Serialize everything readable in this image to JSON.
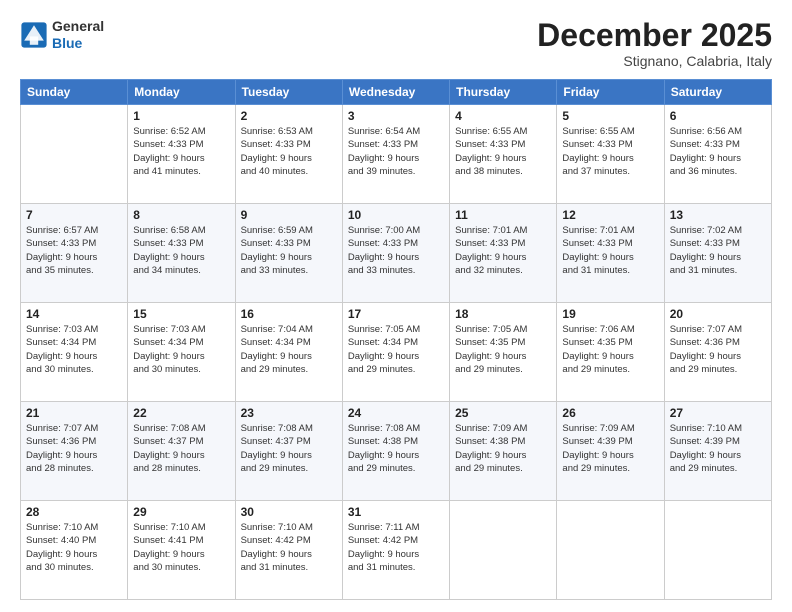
{
  "logo": {
    "general": "General",
    "blue": "Blue"
  },
  "header": {
    "month": "December 2025",
    "location": "Stignano, Calabria, Italy"
  },
  "weekdays": [
    "Sunday",
    "Monday",
    "Tuesday",
    "Wednesday",
    "Thursday",
    "Friday",
    "Saturday"
  ],
  "weeks": [
    [
      {
        "day": "",
        "info": ""
      },
      {
        "day": "1",
        "info": "Sunrise: 6:52 AM\nSunset: 4:33 PM\nDaylight: 9 hours\nand 41 minutes."
      },
      {
        "day": "2",
        "info": "Sunrise: 6:53 AM\nSunset: 4:33 PM\nDaylight: 9 hours\nand 40 minutes."
      },
      {
        "day": "3",
        "info": "Sunrise: 6:54 AM\nSunset: 4:33 PM\nDaylight: 9 hours\nand 39 minutes."
      },
      {
        "day": "4",
        "info": "Sunrise: 6:55 AM\nSunset: 4:33 PM\nDaylight: 9 hours\nand 38 minutes."
      },
      {
        "day": "5",
        "info": "Sunrise: 6:55 AM\nSunset: 4:33 PM\nDaylight: 9 hours\nand 37 minutes."
      },
      {
        "day": "6",
        "info": "Sunrise: 6:56 AM\nSunset: 4:33 PM\nDaylight: 9 hours\nand 36 minutes."
      }
    ],
    [
      {
        "day": "7",
        "info": "Sunrise: 6:57 AM\nSunset: 4:33 PM\nDaylight: 9 hours\nand 35 minutes."
      },
      {
        "day": "8",
        "info": "Sunrise: 6:58 AM\nSunset: 4:33 PM\nDaylight: 9 hours\nand 34 minutes."
      },
      {
        "day": "9",
        "info": "Sunrise: 6:59 AM\nSunset: 4:33 PM\nDaylight: 9 hours\nand 33 minutes."
      },
      {
        "day": "10",
        "info": "Sunrise: 7:00 AM\nSunset: 4:33 PM\nDaylight: 9 hours\nand 33 minutes."
      },
      {
        "day": "11",
        "info": "Sunrise: 7:01 AM\nSunset: 4:33 PM\nDaylight: 9 hours\nand 32 minutes."
      },
      {
        "day": "12",
        "info": "Sunrise: 7:01 AM\nSunset: 4:33 PM\nDaylight: 9 hours\nand 31 minutes."
      },
      {
        "day": "13",
        "info": "Sunrise: 7:02 AM\nSunset: 4:33 PM\nDaylight: 9 hours\nand 31 minutes."
      }
    ],
    [
      {
        "day": "14",
        "info": "Sunrise: 7:03 AM\nSunset: 4:34 PM\nDaylight: 9 hours\nand 30 minutes."
      },
      {
        "day": "15",
        "info": "Sunrise: 7:03 AM\nSunset: 4:34 PM\nDaylight: 9 hours\nand 30 minutes."
      },
      {
        "day": "16",
        "info": "Sunrise: 7:04 AM\nSunset: 4:34 PM\nDaylight: 9 hours\nand 29 minutes."
      },
      {
        "day": "17",
        "info": "Sunrise: 7:05 AM\nSunset: 4:34 PM\nDaylight: 9 hours\nand 29 minutes."
      },
      {
        "day": "18",
        "info": "Sunrise: 7:05 AM\nSunset: 4:35 PM\nDaylight: 9 hours\nand 29 minutes."
      },
      {
        "day": "19",
        "info": "Sunrise: 7:06 AM\nSunset: 4:35 PM\nDaylight: 9 hours\nand 29 minutes."
      },
      {
        "day": "20",
        "info": "Sunrise: 7:07 AM\nSunset: 4:36 PM\nDaylight: 9 hours\nand 29 minutes."
      }
    ],
    [
      {
        "day": "21",
        "info": "Sunrise: 7:07 AM\nSunset: 4:36 PM\nDaylight: 9 hours\nand 28 minutes."
      },
      {
        "day": "22",
        "info": "Sunrise: 7:08 AM\nSunset: 4:37 PM\nDaylight: 9 hours\nand 28 minutes."
      },
      {
        "day": "23",
        "info": "Sunrise: 7:08 AM\nSunset: 4:37 PM\nDaylight: 9 hours\nand 29 minutes."
      },
      {
        "day": "24",
        "info": "Sunrise: 7:08 AM\nSunset: 4:38 PM\nDaylight: 9 hours\nand 29 minutes."
      },
      {
        "day": "25",
        "info": "Sunrise: 7:09 AM\nSunset: 4:38 PM\nDaylight: 9 hours\nand 29 minutes."
      },
      {
        "day": "26",
        "info": "Sunrise: 7:09 AM\nSunset: 4:39 PM\nDaylight: 9 hours\nand 29 minutes."
      },
      {
        "day": "27",
        "info": "Sunrise: 7:10 AM\nSunset: 4:39 PM\nDaylight: 9 hours\nand 29 minutes."
      }
    ],
    [
      {
        "day": "28",
        "info": "Sunrise: 7:10 AM\nSunset: 4:40 PM\nDaylight: 9 hours\nand 30 minutes."
      },
      {
        "day": "29",
        "info": "Sunrise: 7:10 AM\nSunset: 4:41 PM\nDaylight: 9 hours\nand 30 minutes."
      },
      {
        "day": "30",
        "info": "Sunrise: 7:10 AM\nSunset: 4:42 PM\nDaylight: 9 hours\nand 31 minutes."
      },
      {
        "day": "31",
        "info": "Sunrise: 7:11 AM\nSunset: 4:42 PM\nDaylight: 9 hours\nand 31 minutes."
      },
      {
        "day": "",
        "info": ""
      },
      {
        "day": "",
        "info": ""
      },
      {
        "day": "",
        "info": ""
      }
    ]
  ]
}
